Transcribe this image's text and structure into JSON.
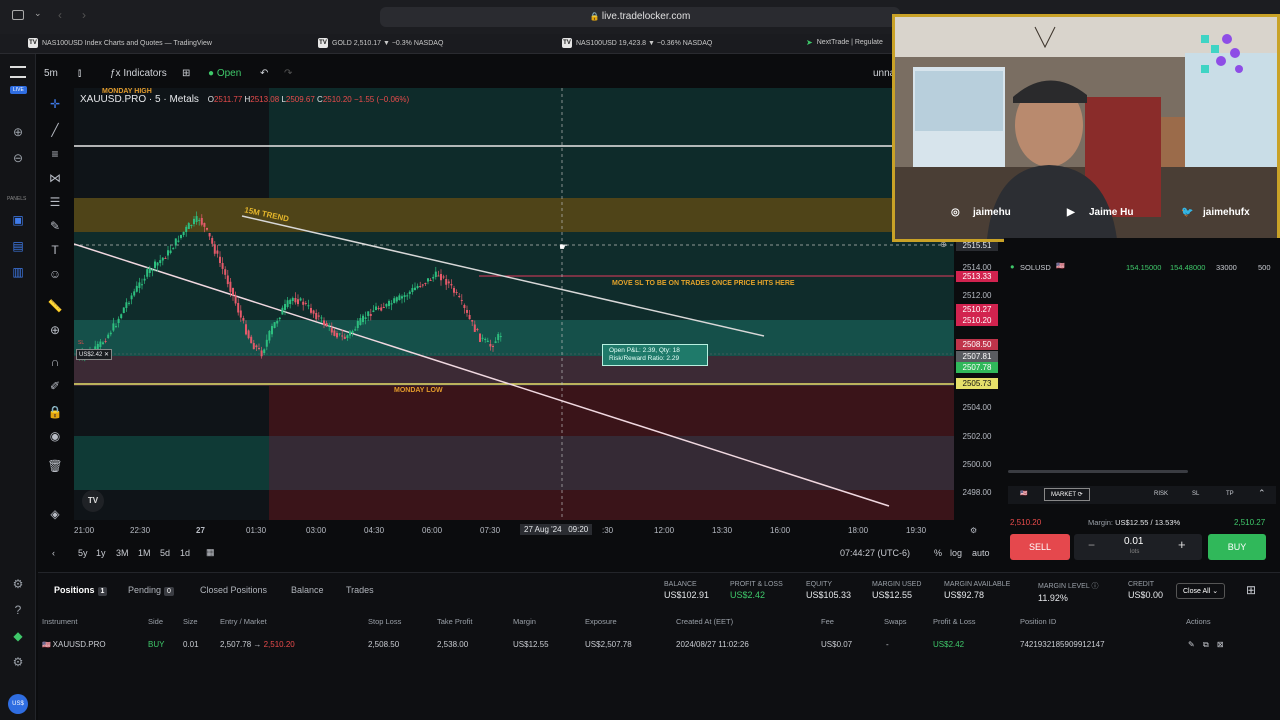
{
  "browser": {
    "url": "live.tradelocker.com",
    "bookmarks": [
      "NAS100USD Index Charts and Quotes — TradingView",
      "GOLD 2,510.17 ▼ −0.3% NASDAQ",
      "NAS100USD 19,423.8 ▼ −0.36% NASDAQ",
      "NextTrade | Regulate"
    ]
  },
  "left_bar": {
    "live_badge": "LIVE",
    "panels_label": "PANELS",
    "user_badge": "US$"
  },
  "toolbar": {
    "interval": "5m",
    "indicators": "Indicators",
    "market_status": "Open",
    "layout_name": "unna"
  },
  "legend": {
    "symbol": "XAUUSD.PRO · 5 · Metals",
    "o_label": "O",
    "o": "2511.77",
    "h_label": "H",
    "h": "2513.08",
    "l_label": "L",
    "l": "2509.67",
    "c_label": "C",
    "c": "2510.20",
    "change": "−1.55 (−0.06%)"
  },
  "annotations": {
    "monday_high": "MONDAY HIGH",
    "trend": "15M TREND",
    "move_sl": "MOVE SL TO BE ON TRADES ONCE PRICE HITS HERE",
    "monday_low": "MONDAY LOW",
    "position_label": "US$2.42",
    "sl_tag": "SL",
    "pnl_line1": "Open P&L: 2.39, Qty: 18",
    "pnl_line2": "Risk/Reward Ratio: 2.29"
  },
  "price_axis": {
    "ticks": [
      "2515.51",
      "2514.00",
      "2513.33",
      "2512.00",
      "2510.27",
      "2510.20",
      "2508.50",
      "2507.81",
      "2507.78",
      "2505.73",
      "2504.00",
      "2502.00",
      "2500.00",
      "2498.00"
    ]
  },
  "time_axis": {
    "ticks": [
      "21:00",
      "22:30",
      "27",
      "01:30",
      "03:00",
      "04:30",
      "06:00",
      "07:30",
      "27 Aug '24   09:20",
      ":30",
      "12:00",
      "13:30",
      "16:00",
      "18:00",
      "19:30"
    ]
  },
  "range_bar": {
    "ranges": [
      "5y",
      "1y",
      "3M",
      "1M",
      "5d",
      "1d"
    ],
    "clock": "07:44:27 (UTC-6)",
    "pct": "%",
    "log": "log",
    "auto": "auto"
  },
  "webcam": {
    "instagram": "jaimehu",
    "youtube": "Jaime Hu",
    "twitter": "jaimehufx"
  },
  "watchlist": {
    "symbol": "SOLUSD",
    "bid": "154.15000",
    "ask": "154.48000",
    "volume": "33000",
    "spread": "500"
  },
  "order_panel": {
    "type": "MARKET",
    "risk": "RISK",
    "sl": "SL",
    "tp": "TP",
    "sell_price": "2,510.20",
    "buy_price": "2,510.27",
    "margin_label": "Margin:",
    "margin_value": "US$12.55 / 13.53%",
    "sell": "SELL",
    "buy": "BUY",
    "lots": "0.01",
    "lots_label": "lots",
    "minus": "−",
    "plus": "+"
  },
  "bottom": {
    "tabs": [
      {
        "label": "Positions",
        "count": "1"
      },
      {
        "label": "Pending",
        "count": "0"
      },
      {
        "label": "Closed Positions"
      },
      {
        "label": "Balance"
      },
      {
        "label": "Trades"
      }
    ],
    "stats": [
      {
        "label": "BALANCE",
        "value": "US$102.91"
      },
      {
        "label": "PROFIT & LOSS",
        "value": "US$2.42"
      },
      {
        "label": "EQUITY",
        "value": "US$105.33"
      },
      {
        "label": "MARGIN USED",
        "value": "US$12.55"
      },
      {
        "label": "MARGIN AVAILABLE",
        "value": "US$92.78"
      },
      {
        "label": "MARGIN LEVEL",
        "value": "11.92%"
      },
      {
        "label": "CREDIT",
        "value": "US$0.00"
      }
    ],
    "close_all": "Close All",
    "headers": [
      "Instrument",
      "Side",
      "Size",
      "Entry / Market",
      "Stop Loss",
      "Take Profit",
      "Margin",
      "Exposure",
      "Created At (EET)",
      "Fee",
      "Swaps",
      "Profit & Loss",
      "Position ID",
      "Actions"
    ],
    "row": {
      "instrument": "XAUUSD.PRO",
      "side": "BUY",
      "size": "0.01",
      "entry": "2,507.78",
      "arrow": "→",
      "market": "2,510.20",
      "stop_loss": "2,508.50",
      "take_profit": "2,538.00",
      "margin": "US$12.55",
      "exposure": "US$2,507.78",
      "created": "2024/08/27 11:02:26",
      "fee": "US$0.07",
      "swaps": "-",
      "pnl": "US$2.42",
      "position_id": "7421932185909912147"
    }
  },
  "colors": {
    "accent_green": "#30b85a",
    "accent_red": "#e5484d",
    "zone_orange": "#6b5a1a",
    "zone_teal": "#134a45",
    "zone_maroon": "#3a1418",
    "webcam_border": "#c9a227"
  }
}
